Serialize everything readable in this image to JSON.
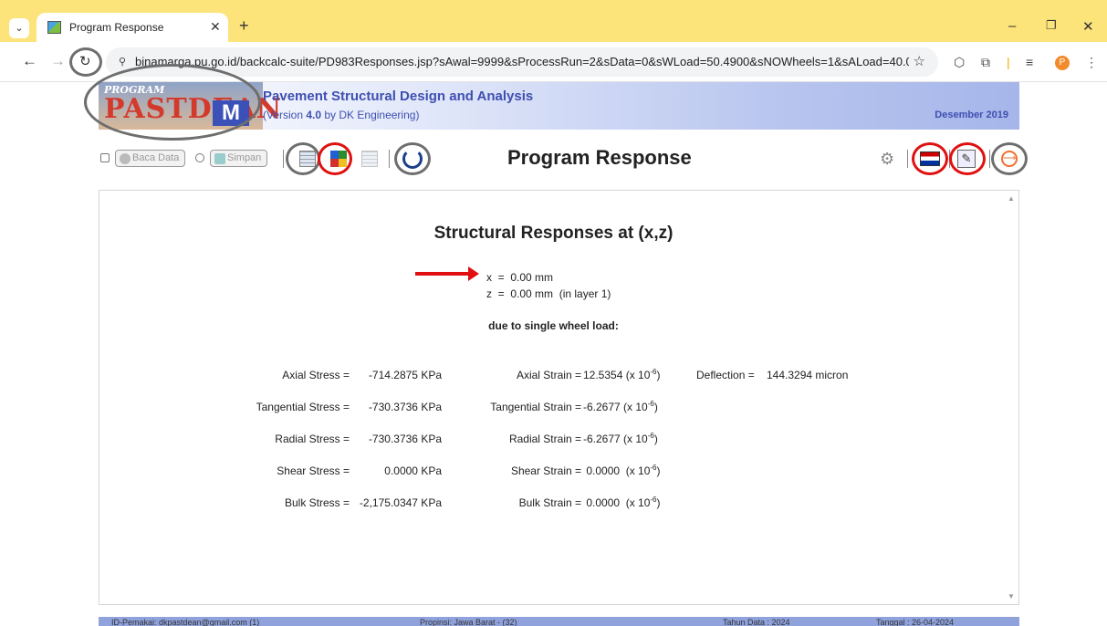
{
  "browser": {
    "tab_title": "Program Response",
    "url": "binamarga.pu.go.id/backcalc-suite/PD983Responses.jsp?sAwal=9999&sProcessRun=2&sData=0&sWLoad=50.4900&sNOWheels=1&sALoad=40.00&sTP...",
    "profile_initial": "P"
  },
  "banner": {
    "logo_program": "PROGRAM",
    "logo_main": "PASTDEAN",
    "logo_m": "M",
    "title": "Pavement Structural Design and Analysis",
    "version_prefix": "(Version ",
    "version_number": "4.0",
    "version_suffix": " by DK Engineering)",
    "date": "Desember 2019"
  },
  "actions": {
    "baca_data": "Baca Data",
    "simpan": "Simpan",
    "page_title": "Program Response"
  },
  "response": {
    "title": "Structural Responses at (x,z)",
    "x_line": "x  =  0.00 mm",
    "z_line": "z  =  0.00 mm  (in layer 1)",
    "load_note": "due to single wheel load:",
    "rows": [
      {
        "stress_label": "Axial Stress  =",
        "stress_value": "-714.2875 KPa",
        "strain_label": "Axial Strain  =",
        "strain_value": "12.5354  (x 10",
        "strain_exp": "-6",
        "strain_close": ")"
      },
      {
        "stress_label": "Tangential Stress  =",
        "stress_value": "-730.3736 KPa",
        "strain_label": "Tangential Strain  =",
        "strain_value": "-6.2677  (x 10",
        "strain_exp": "-6",
        "strain_close": ")"
      },
      {
        "stress_label": "Radial Stress  =",
        "stress_value": "-730.3736 KPa",
        "strain_label": "Radial Strain  =",
        "strain_value": "-6.2677  (x 10",
        "strain_exp": "-6",
        "strain_close": ")"
      },
      {
        "stress_label": "Shear Stress  =",
        "stress_value": "0.0000 KPa",
        "strain_label": "Shear Strain  =",
        "strain_value": " 0.0000  (x 10",
        "strain_exp": "-6",
        "strain_close": ")"
      },
      {
        "stress_label": "Bulk Stress  =",
        "stress_value": "-2,175.0347 KPa",
        "strain_label": "Bulk Strain  =",
        "strain_value": " 0.0000  (x 10",
        "strain_exp": "-6",
        "strain_close": ")"
      }
    ],
    "deflection_label": "Deflection  =",
    "deflection_value": "144.3294  micron"
  },
  "footer": {
    "user": "ID-Pemakai: dkpastdean@gmail.com (1)",
    "province": "Propinsi: Jawa Barat - (32)",
    "year": "Tahun Data : 2024",
    "date": "Tanggal : 26-04-2024"
  },
  "colors": {
    "annotation_red": "#e01010",
    "annotation_gray": "#6e6e6e",
    "banner_blue": "#3f4fb0",
    "tabbar_yellow": "#fde47a"
  }
}
